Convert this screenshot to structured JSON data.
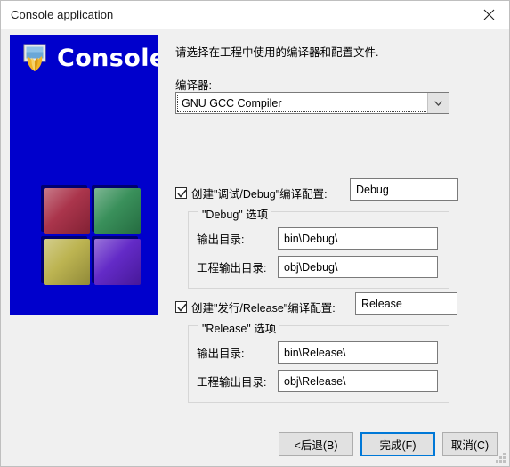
{
  "window": {
    "title": "Console application",
    "close_icon": "close-icon"
  },
  "banner": {
    "title": "Console",
    "icon": "console-window-icon",
    "background_color": "#0000cc",
    "cubes": [
      {
        "name": "cube-red",
        "color": "#a62a42"
      },
      {
        "name": "cube-green",
        "color": "#2f8a52"
      },
      {
        "name": "cube-yellow",
        "color": "#b9b048"
      },
      {
        "name": "cube-purple",
        "color": "#5b1fc4"
      }
    ]
  },
  "main": {
    "instruction": "请选择在工程中使用的编译器和配置文件.",
    "compiler": {
      "label": "编译器:",
      "selected": "GNU GCC Compiler",
      "arrow_icon": "chevron-down-icon"
    },
    "debug": {
      "checkbox_label": "创建\"调试/Debug\"编译配置:",
      "checked": true,
      "name_value": "Debug",
      "group_title": "\"Debug\" 选项",
      "output_dir_label": "输出目录:",
      "output_dir_value": "bin\\Debug\\",
      "objects_dir_label": "工程输出目录:",
      "objects_dir_value": "obj\\Debug\\"
    },
    "release": {
      "checkbox_label": "创建\"发行/Release\"编译配置:",
      "checked": true,
      "name_value": "Release",
      "group_title": "\"Release\" 选项",
      "output_dir_label": "输出目录:",
      "output_dir_value": "bin\\Release\\",
      "objects_dir_label": "工程输出目录:",
      "objects_dir_value": "obj\\Release\\"
    }
  },
  "footer": {
    "back_button": "<后退(B)",
    "finish_button": "完成(F)",
    "cancel_button": "取消(C)",
    "focused_button": "完成(F)",
    "focus_color": "#0078d7",
    "resize_grip_icon": "resize-grip-icon"
  }
}
